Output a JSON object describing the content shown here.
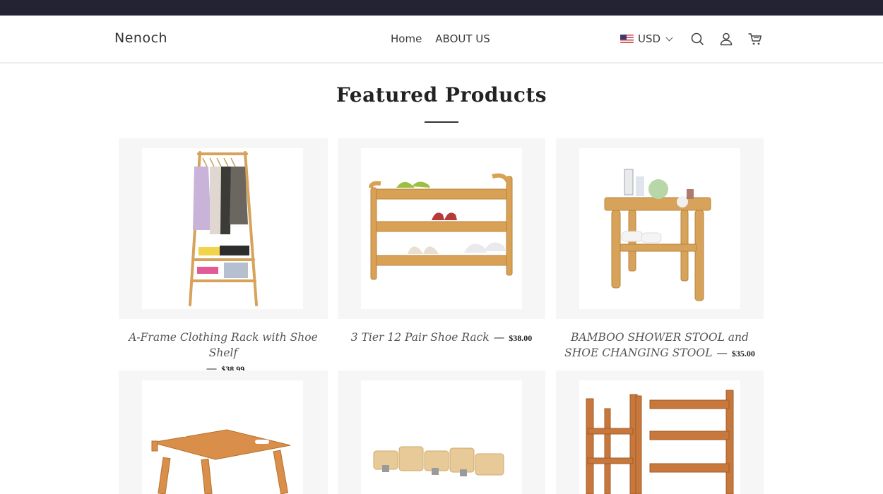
{
  "header": {
    "brand": "Nenoch",
    "nav": [
      "Home",
      "ABOUT US"
    ],
    "currency": "USD"
  },
  "section": {
    "title": "Featured Products"
  },
  "products": [
    {
      "name": "A-Frame Clothing Rack with Shoe Shelf",
      "price": "$38.99"
    },
    {
      "name": "3 Tier 12 Pair Shoe Rack",
      "price": "$38.00"
    },
    {
      "name": "BAMBOO SHOWER STOOL and SHOE CHANGING STOOL",
      "price": "$35.00"
    },
    {
      "name": "",
      "price": ""
    },
    {
      "name": "",
      "price": ""
    },
    {
      "name": "",
      "price": ""
    }
  ],
  "colors": {
    "topbar": "#232334",
    "bamboo": "#d7a25a",
    "card_bg": "#f6f6f6"
  },
  "icons": [
    "us-flag-icon",
    "chevron-down-icon",
    "search-icon",
    "user-icon",
    "cart-icon"
  ]
}
